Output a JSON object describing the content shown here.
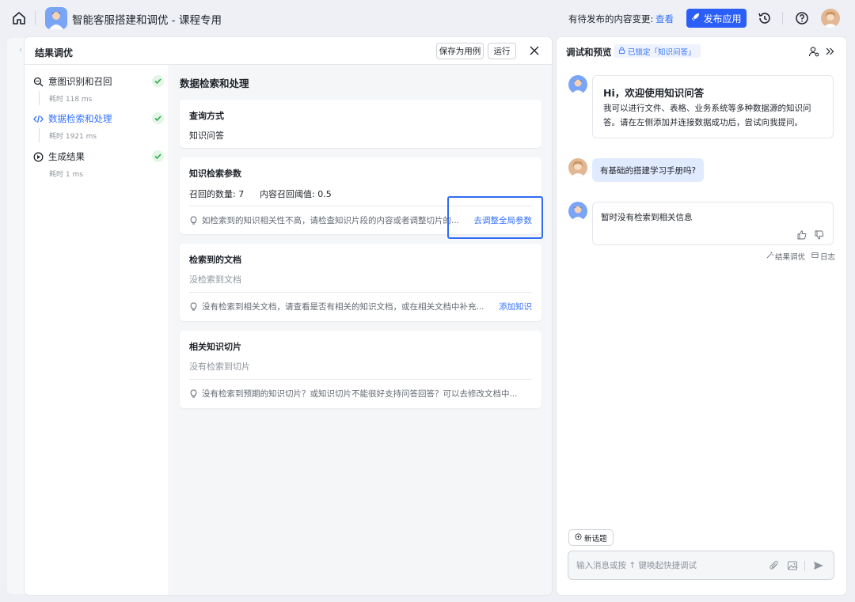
{
  "topbar": {
    "app_title": "智能客服搭建和调优 - 课程专用",
    "pending_text": "有待发布的内容变更:",
    "pending_link": "查看",
    "publish_label": "发布应用",
    "icons": [
      "home-icon",
      "history-icon",
      "help-icon",
      "rocket-icon"
    ]
  },
  "left_panel": {
    "title": "结果调优",
    "save_label": "保存为用例",
    "run_label": "运行",
    "steps": [
      {
        "label": "意图识别和召回",
        "time": "耗时 118 ms",
        "icon": "search-icon",
        "done": true
      },
      {
        "label": "数据检索和处理",
        "time": "耗时 1921 ms",
        "icon": "code-icon",
        "done": true,
        "active": true
      },
      {
        "label": "生成结果",
        "time": "耗时 1 ms",
        "icon": "play-icon",
        "done": true
      }
    ],
    "content_title": "数据检索和处理",
    "cards": {
      "query": {
        "title": "查询方式",
        "value": "知识问答"
      },
      "params": {
        "title": "知识检索参数",
        "recall_count": "召回的数量:  7",
        "threshold": "内容召回阈值:  0.5",
        "tip": "如检索到的知识相关性不高，请检查知识片段的内容或者调整切片的...",
        "link": "去调整全局参数"
      },
      "docs": {
        "title": "检索到的文档",
        "empty": "没检索到文档",
        "tip": "没有检索到相关文档，请查看是否有相关的知识文档，或在相关文档中补充...",
        "link": "添加知识"
      },
      "slices": {
        "title": "相关知识切片",
        "empty": "没有检索到切片",
        "tip": "没有检索到预期的知识切片？或知识切片不能很好支持问答回答？可以去修改文档中..."
      }
    }
  },
  "right_panel": {
    "title": "调试和预览",
    "locked_tag": "已锁定「知识问答」",
    "welcome_title": "Hi，欢迎使用知识问答",
    "welcome_text": "我可以进行文件、表格、业务系统等多种数据源的知识问答。请在左侧添加并连接数据成功后，尝试向我提问。",
    "user_message": "有基础的搭建学习手册吗?",
    "bot_reply": "暂时没有检索到相关信息",
    "meta_tune": "结果调优",
    "meta_log": "日志",
    "new_topic": "新话题",
    "input_placeholder": "输入消息或按 ↑ 键唤起快捷调试"
  },
  "colors": {
    "accent": "#3370ff",
    "publish": "#2a5ef7",
    "success": "#34a853",
    "highlight_border": "#2f6bf3"
  }
}
